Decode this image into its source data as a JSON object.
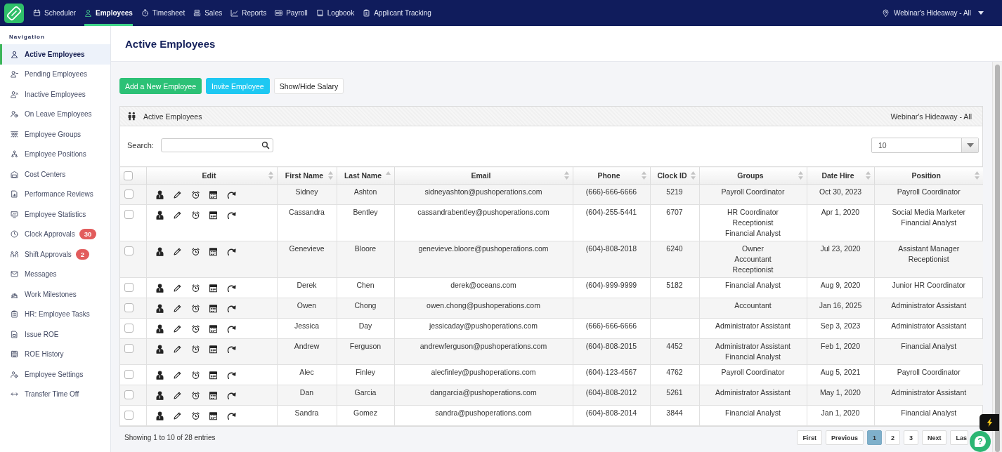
{
  "top_nav": {
    "items": [
      {
        "label": "Scheduler",
        "selected": false
      },
      {
        "label": "Employees",
        "selected": true
      },
      {
        "label": "Timesheet",
        "selected": false
      },
      {
        "label": "Sales",
        "selected": false
      },
      {
        "label": "Reports",
        "selected": false
      },
      {
        "label": "Payroll",
        "selected": false
      },
      {
        "label": "Logbook",
        "selected": false
      },
      {
        "label": "Applicant Tracking",
        "selected": false
      }
    ],
    "location": "Webinar's Hideaway - All"
  },
  "sidebar": {
    "heading": "Navigation",
    "items": [
      {
        "label": "Active Employees",
        "selected": true
      },
      {
        "label": "Pending Employees",
        "selected": false
      },
      {
        "label": "Inactive Employees",
        "selected": false
      },
      {
        "label": "On Leave Employees",
        "selected": false
      },
      {
        "label": "Employee Groups",
        "selected": false
      },
      {
        "label": "Employee Positions",
        "selected": false
      },
      {
        "label": "Cost Centers",
        "selected": false
      },
      {
        "label": "Performance Reviews",
        "selected": false
      },
      {
        "label": "Employee Statistics",
        "selected": false
      },
      {
        "label": "Clock Approvals",
        "selected": false,
        "badge": "30"
      },
      {
        "label": "Shift Approvals",
        "selected": false,
        "badge": "2"
      },
      {
        "label": "Messages",
        "selected": false
      },
      {
        "label": "Work Milestones",
        "selected": false
      },
      {
        "label": "HR: Employee Tasks",
        "selected": false
      },
      {
        "label": "Issue ROE",
        "selected": false
      },
      {
        "label": "ROE History",
        "selected": false
      },
      {
        "label": "Employee Settings",
        "selected": false
      },
      {
        "label": "Transfer Time Off",
        "selected": false
      }
    ]
  },
  "page": {
    "title": "Active Employees",
    "buttons": [
      {
        "label": "Add a New Employee",
        "kind": "success"
      },
      {
        "label": "Invite Employee",
        "kind": "info"
      },
      {
        "label": "Show/Hide Salary",
        "kind": "default"
      }
    ]
  },
  "panel": {
    "title": "Active Employees",
    "location": "Webinar's Hideaway - All",
    "search": {
      "label": "Search:"
    },
    "page_size": "10"
  },
  "table": {
    "select_all": {
      "checked": false
    },
    "columns": [
      {
        "label": "Edit",
        "sorted": false
      },
      {
        "label": "First Name",
        "sorted": false
      },
      {
        "label": "Last Name",
        "sorted": true
      },
      {
        "label": "Email",
        "sorted": false
      },
      {
        "label": "Phone",
        "sorted": false
      },
      {
        "label": "Clock ID",
        "sorted": false
      },
      {
        "label": "Groups",
        "sorted": false
      },
      {
        "label": "Date Hire",
        "sorted": false
      },
      {
        "label": "Position",
        "sorted": false
      }
    ],
    "rows": [
      {
        "checked": false,
        "first_name": "Sidney",
        "last_name": "Ashton",
        "email": "sidneyashton@pushoperations.com",
        "phone": "(666)-666-6666",
        "clock_id": "5219",
        "groups": [
          "Payroll Coordinator"
        ],
        "date_hire": "Oct 30, 2023",
        "positions": [
          "Payroll Coordinator"
        ]
      },
      {
        "checked": false,
        "first_name": "Cassandra",
        "last_name": "Bentley",
        "email": "cassandrabentley@pushoperations.com",
        "phone": "(604)-255-5441",
        "clock_id": "6707",
        "groups": [
          "HR Coordinator",
          "Receptionist",
          "Financial Analyst"
        ],
        "date_hire": "Apr 1, 2020",
        "positions": [
          "Social Media Marketer",
          "Financial Analyst"
        ]
      },
      {
        "checked": false,
        "first_name": "Genevieve",
        "last_name": "Bloore",
        "email": "genevieve.bloore@pushoperations.com",
        "phone": "(604)-808-2018",
        "clock_id": "6240",
        "groups": [
          "Owner",
          "Accountant",
          "Receptionist"
        ],
        "date_hire": "Jul 23, 2020",
        "positions": [
          "Assistant Manager",
          "Receptionist"
        ]
      },
      {
        "checked": false,
        "first_name": "Derek",
        "last_name": "Chen",
        "email": "derek@oceans.com",
        "phone": "(604)-999-9999",
        "clock_id": "5182",
        "groups": [
          "Financial Analyst"
        ],
        "date_hire": "Aug 9, 2020",
        "positions": [
          "Junior HR Coordinator"
        ]
      },
      {
        "checked": false,
        "first_name": "Owen",
        "last_name": "Chong",
        "email": "owen.chong@pushoperations.com",
        "groups": [
          "Accountant"
        ],
        "date_hire": "Jan 16, 2025",
        "positions": [
          "Administrator Assistant"
        ]
      },
      {
        "checked": false,
        "first_name": "Jessica",
        "last_name": "Day",
        "email": "jessicaday@pushoperations.com",
        "phone": "(666)-666-6666",
        "groups": [
          "Administrator Assistant"
        ],
        "date_hire": "Sep 3, 2023",
        "positions": [
          "Administrator Assistant"
        ]
      },
      {
        "checked": false,
        "first_name": "Andrew",
        "last_name": "Ferguson",
        "email": "andrewferguson@pushoperations.com",
        "phone": "(604)-808-2015",
        "clock_id": "4452",
        "groups": [
          "Administrator Assistant",
          "Financial Analyst"
        ],
        "date_hire": "Feb 1, 2020",
        "positions": [
          "Financial Analyst"
        ]
      },
      {
        "checked": false,
        "first_name": "Alec",
        "last_name": "Finley",
        "email": "alecfinley@pushoperations.com",
        "phone": "(604)-123-4567",
        "clock_id": "4762",
        "groups": [
          "Payroll Coordinator"
        ],
        "date_hire": "Aug 5, 2021",
        "positions": [
          "Payroll Coordinator"
        ]
      },
      {
        "checked": false,
        "first_name": "Dan",
        "last_name": "Garcia",
        "email": "dangarcia@pushoperations.com",
        "phone": "(604)-808-2012",
        "clock_id": "5261",
        "groups": [
          "Administrator Assistant"
        ],
        "date_hire": "May 1, 2020",
        "positions": [
          "Administrator Assistant"
        ]
      },
      {
        "checked": false,
        "first_name": "Sandra",
        "last_name": "Gomez",
        "email": "sandra@pushoperations.com",
        "phone": "(604)-808-2014",
        "clock_id": "3844",
        "groups": [
          "Financial Analyst"
        ],
        "date_hire": "Jan 1, 2020",
        "positions": [
          "Financial Analyst"
        ]
      }
    ]
  },
  "footer": {
    "info": "Showing 1 to 10 of 28 entries",
    "pages": [
      {
        "label": "First",
        "selected": false
      },
      {
        "label": "Previous",
        "selected": false
      },
      {
        "label": "1",
        "selected": true
      },
      {
        "label": "2",
        "selected": false
      },
      {
        "label": "3",
        "selected": false
      },
      {
        "label": "Next",
        "selected": false
      },
      {
        "label": "Las",
        "selected": false
      }
    ]
  },
  "help_button": {
    "label": "?"
  }
}
